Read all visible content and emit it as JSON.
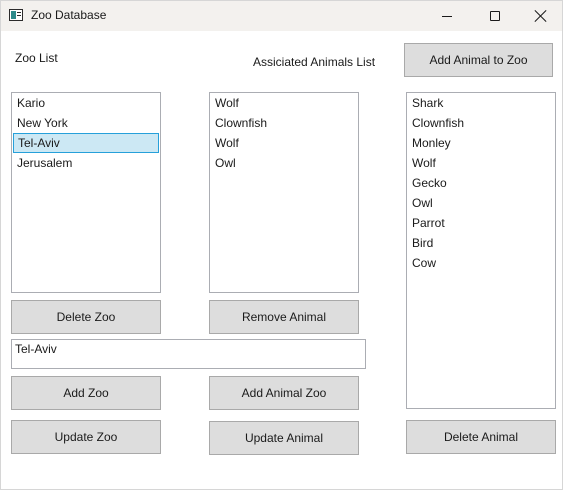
{
  "window": {
    "title": "Zoo Database"
  },
  "labels": {
    "zoo_list": "Zoo List",
    "associated_animals_list": "Assiciated Animals List"
  },
  "zoo_list": {
    "items": [
      "Kario",
      "New York",
      "Tel-Aviv",
      "Jerusalem"
    ],
    "selected": "Tel-Aviv"
  },
  "associated_animals": {
    "items": [
      "Wolf",
      "Clownfish",
      "Wolf",
      "Owl"
    ]
  },
  "all_animals": {
    "items": [
      "Shark",
      "Clownfish",
      "Monley",
      "Wolf",
      "Gecko",
      "Owl",
      "Parrot",
      "Bird",
      "Cow"
    ]
  },
  "input": {
    "value": "Tel-Aviv"
  },
  "buttons": {
    "add_animal_to_zoo": "Add Animal to Zoo",
    "delete_zoo": "Delete Zoo",
    "remove_animal": "Remove Animal",
    "add_zoo": "Add Zoo",
    "add_animal_zoo": "Add Animal Zoo",
    "update_zoo": "Update Zoo",
    "update_animal": "Update Animal",
    "delete_animal": "Delete Animal"
  },
  "colors": {
    "selection_fill": "#cce8f4",
    "selection_border": "#26a0da",
    "button_fill": "#dddddd",
    "titlebar": "#f3f1ee"
  }
}
